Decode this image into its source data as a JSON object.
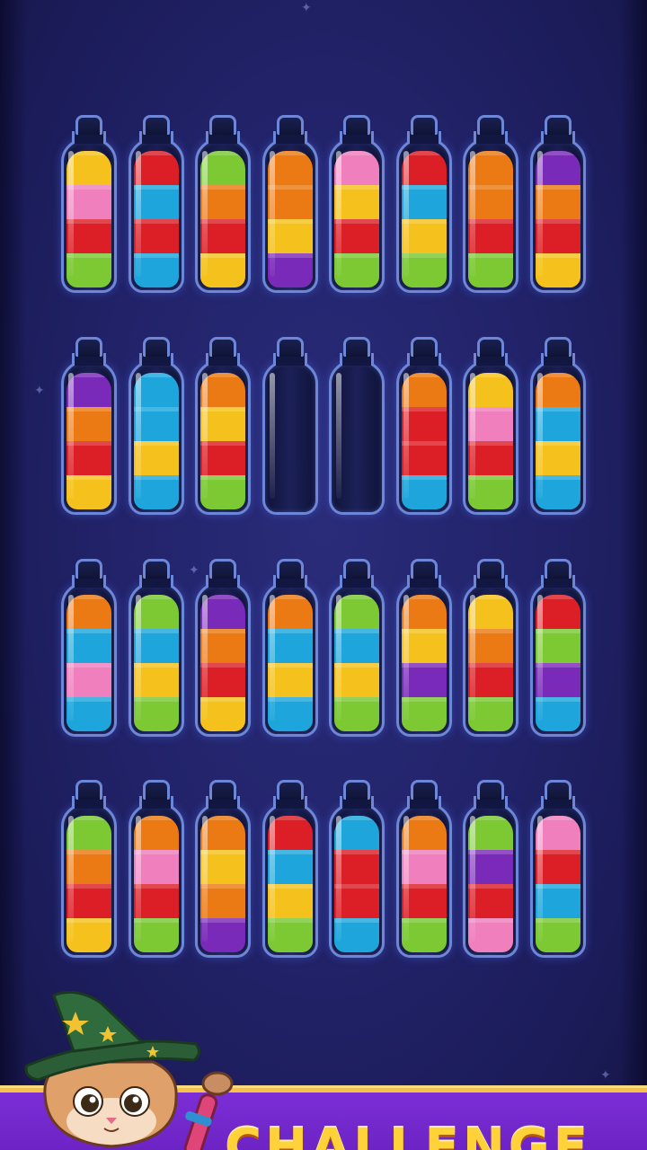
{
  "palette": {
    "yellow": "#f5c21d",
    "pink": "#f07fbe",
    "red": "#dc1f26",
    "green": "#7cc934",
    "blue": "#1ea6dc",
    "orange": "#ec7a14",
    "purple": "#7a2ab8"
  },
  "rows": [
    [
      [
        "yellow",
        "pink",
        "red",
        "green"
      ],
      [
        "red",
        "blue",
        "red",
        "blue"
      ],
      [
        "green",
        "orange",
        "red",
        "yellow"
      ],
      [
        "orange",
        "orange",
        "yellow",
        "purple"
      ],
      [
        "pink",
        "yellow",
        "red",
        "green"
      ],
      [
        "red",
        "blue",
        "yellow",
        "green"
      ],
      [
        "orange",
        "orange",
        "red",
        "green"
      ],
      [
        "purple",
        "orange",
        "red",
        "yellow"
      ]
    ],
    [
      [
        "purple",
        "orange",
        "red",
        "yellow"
      ],
      [
        "blue",
        "blue",
        "yellow",
        "blue"
      ],
      [
        "orange",
        "yellow",
        "red",
        "green"
      ],
      [],
      [],
      [
        "orange",
        "red",
        "red",
        "blue"
      ],
      [
        "yellow",
        "pink",
        "red",
        "green"
      ],
      [
        "orange",
        "blue",
        "yellow",
        "blue"
      ]
    ],
    [
      [
        "orange",
        "blue",
        "pink",
        "blue"
      ],
      [
        "green",
        "blue",
        "yellow",
        "green"
      ],
      [
        "purple",
        "orange",
        "red",
        "yellow"
      ],
      [
        "orange",
        "blue",
        "yellow",
        "blue"
      ],
      [
        "green",
        "blue",
        "yellow",
        "green"
      ],
      [
        "orange",
        "yellow",
        "purple",
        "green"
      ],
      [
        "yellow",
        "orange",
        "red",
        "green"
      ],
      [
        "red",
        "green",
        "purple",
        "blue"
      ]
    ],
    [
      [
        "green",
        "orange",
        "red",
        "yellow"
      ],
      [
        "orange",
        "pink",
        "red",
        "green"
      ],
      [
        "orange",
        "yellow",
        "orange",
        "purple"
      ],
      [
        "red",
        "blue",
        "yellow",
        "green"
      ],
      [
        "blue",
        "red",
        "red",
        "blue"
      ],
      [
        "orange",
        "pink",
        "red",
        "green"
      ],
      [
        "green",
        "purple",
        "red",
        "pink"
      ],
      [
        "pink",
        "red",
        "blue",
        "green"
      ]
    ]
  ],
  "banner": {
    "text": "CHALLENGE"
  },
  "mascot": {
    "name": "wizard-cat-mascot",
    "hat_color": "#2f6b3c",
    "star_color": "#f1c232"
  }
}
